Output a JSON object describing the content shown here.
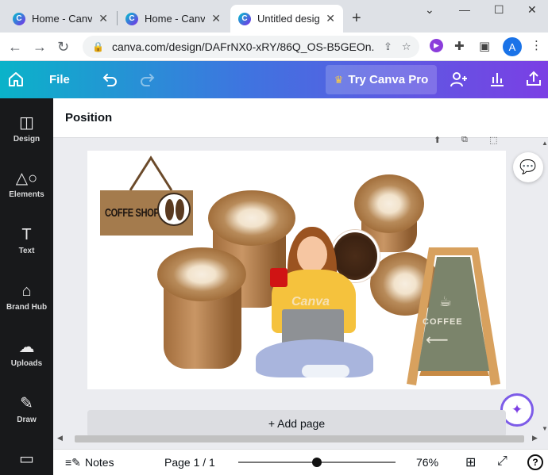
{
  "browser": {
    "tabs": [
      {
        "title": "Home - Canva",
        "active": false
      },
      {
        "title": "Home - Canva",
        "active": false
      },
      {
        "title": "Untitled design",
        "active": true
      }
    ],
    "new_tab_icon": "plus-icon",
    "address": "canva.com/design/DAFrNX0-xRY/86Q_OS-B5GEOn...",
    "profile_initial": "A"
  },
  "canva": {
    "file_label": "File",
    "try_pro_label": "Try Canva Pro",
    "brand_gradient": [
      "#0ab3c9",
      "#3f74e0",
      "#7b3fe4"
    ]
  },
  "sidebar": {
    "items": [
      {
        "label": "Design",
        "icon": "design-icon"
      },
      {
        "label": "Elements",
        "icon": "elements-icon"
      },
      {
        "label": "Text",
        "icon": "text-icon"
      },
      {
        "label": "Brand Hub",
        "icon": "brand-hub-icon"
      },
      {
        "label": "Uploads",
        "icon": "uploads-icon"
      },
      {
        "label": "Draw",
        "icon": "draw-icon"
      },
      {
        "label": "",
        "icon": "folder-icon"
      }
    ]
  },
  "editor": {
    "position_label": "Position",
    "add_page_label": "+ Add page"
  },
  "artwork": {
    "sign_text": "COFFE SHOP",
    "watermark": "Canva",
    "board_text": "COFFEE"
  },
  "footer": {
    "notes_label": "Notes",
    "page_label": "Page 1 / 1",
    "zoom_percent": "76%",
    "zoom_fraction": 0.5
  }
}
